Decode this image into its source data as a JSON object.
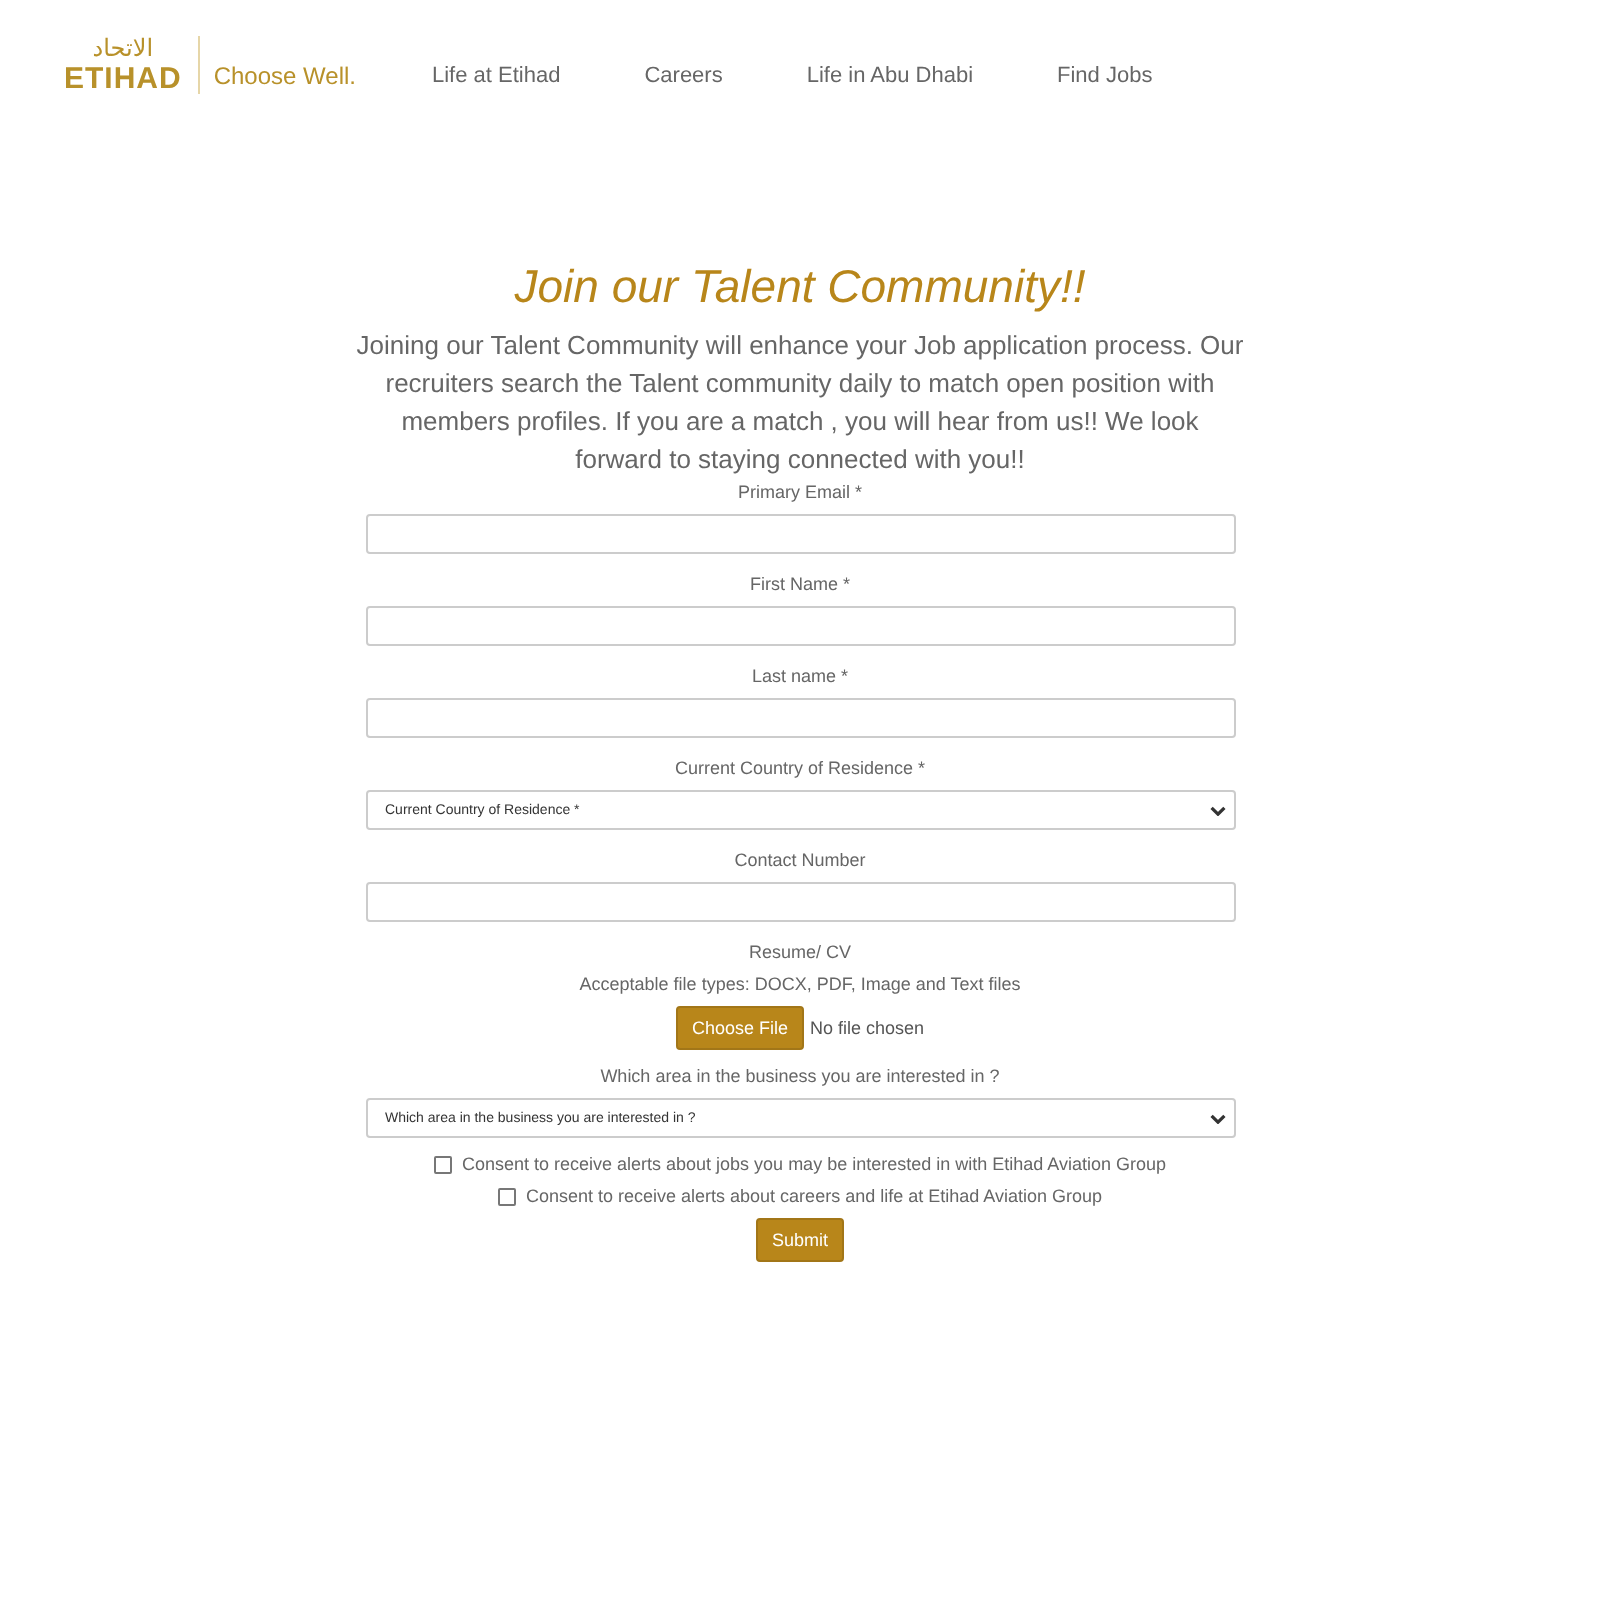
{
  "header": {
    "logo_arabic": "الاتحاد",
    "logo": "ETIHAD",
    "tagline": "Choose Well.",
    "nav": [
      {
        "label": "Life at Etihad"
      },
      {
        "label": "Careers"
      },
      {
        "label": "Life in Abu Dhabi"
      },
      {
        "label": "Find Jobs"
      }
    ]
  },
  "title": "Join our Talent Community!!",
  "intro": "Joining our Talent Community will enhance your Job application process. Our recruiters search the Talent community daily to match open position with members profiles. If you are a match , you will hear from us!! We look forward to staying connected with you!!",
  "fields": [
    {
      "kind": "text",
      "label": "Primary Email *"
    },
    {
      "kind": "text",
      "label": "First Name *"
    },
    {
      "kind": "text",
      "label": "Last name *"
    },
    {
      "kind": "select",
      "label": "Current Country of Residence *",
      "value": "Current Country of Residence *"
    },
    {
      "kind": "text",
      "label": "Contact Number"
    },
    {
      "kind": "file",
      "label": "Resume/ CV",
      "note": "Acceptable file types: DOCX, PDF, Image and Text files",
      "button": "Choose File",
      "status": "No file chosen"
    },
    {
      "kind": "select",
      "label": "Which area in the business you are interested in ?",
      "value": "Which area in the business you are interested in ?"
    }
  ],
  "consents": [
    {
      "label": "Consent to receive alerts about jobs you may be interested in with Etihad Aviation Group",
      "checked": false
    },
    {
      "label": "Consent to receive alerts about careers and life at Etihad Aviation Group",
      "checked": false
    }
  ],
  "submit": "Submit"
}
